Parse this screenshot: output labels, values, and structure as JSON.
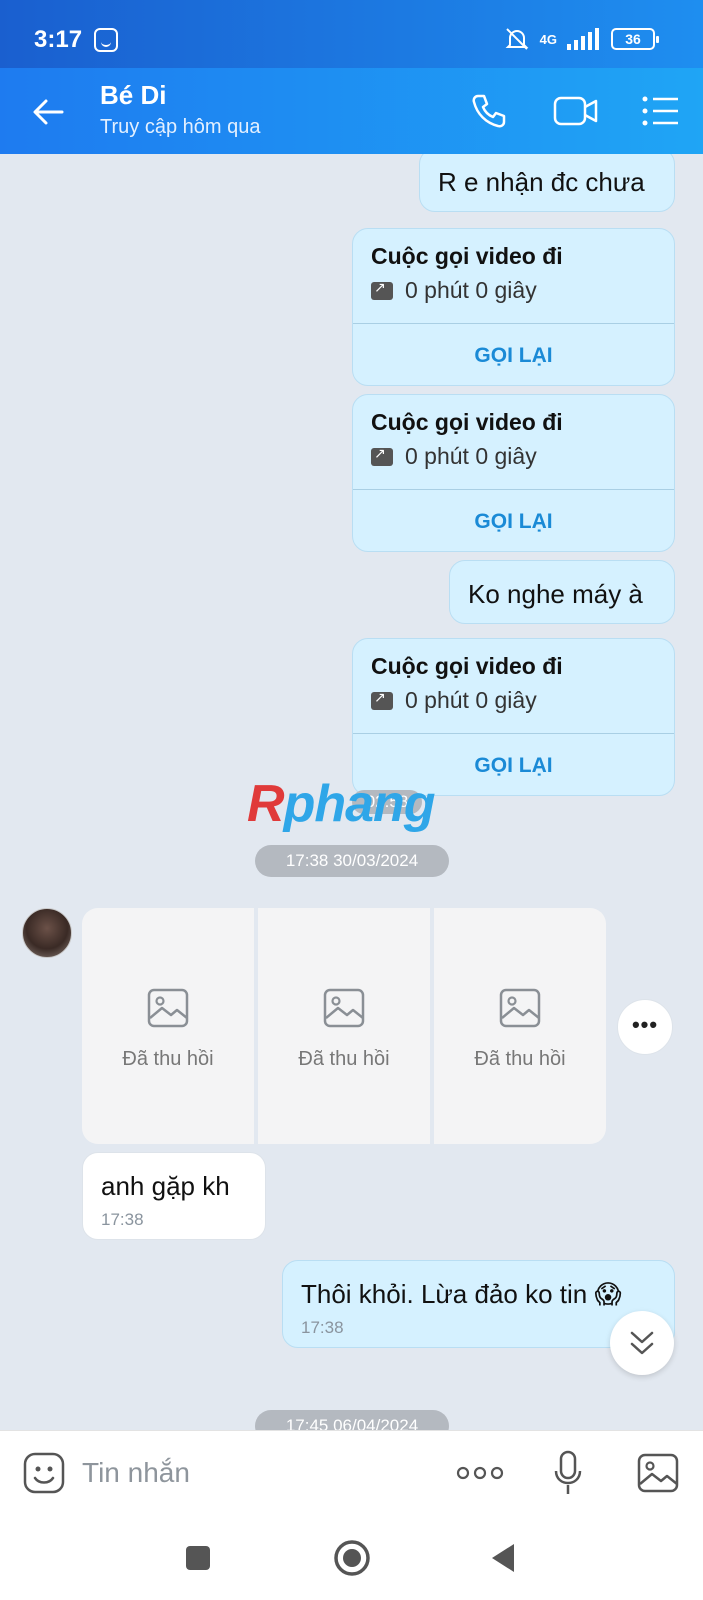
{
  "status_bar": {
    "time": "3:17",
    "network": "4G",
    "battery": "36"
  },
  "header": {
    "contact_name": "Bé Di",
    "contact_status": "Truy cập hôm qua"
  },
  "messages": {
    "m1": "R e nhận đc chưa",
    "m2": "Ko nghe máy à",
    "in_text": "anh gặp kh",
    "in_time": "17:38",
    "out_text": "Thôi khỏi. Lừa đảo ko tin 😱",
    "out_time": "17:38"
  },
  "calls": [
    {
      "title": "Cuộc gọi video đi",
      "duration": "0 phút 0 giây",
      "action": "GỌI LẠI"
    },
    {
      "title": "Cuộc gọi video đi",
      "duration": "0 phút 0 giây",
      "action": "GỌI LẠI"
    },
    {
      "title": "Cuộc gọi video đi",
      "duration": "0 phút 0 giây",
      "action": "GỌI LẠI"
    }
  ],
  "call_time": "02:58",
  "date_separators": [
    "17:38 30/03/2024",
    "17:45 06/04/2024"
  ],
  "recalled": [
    "Đã thu hồi",
    "Đã thu hồi",
    "Đã thu hồi"
  ],
  "more_button": "•••",
  "watermark": {
    "first": "R",
    "rest": "phang"
  },
  "input": {
    "placeholder": "Tin nhắn"
  },
  "icons": [
    "back-arrow-icon",
    "phone-icon",
    "video-call-icon",
    "menu-icon",
    "sticker-icon",
    "more-dots-icon",
    "microphone-icon",
    "image-icon",
    "chevron-double-down-icon"
  ],
  "colors": {
    "header_start": "#1e7bf0",
    "header_end": "#1fa5f5",
    "bubble_out": "#d5f1ff",
    "link": "#1a8ad6",
    "chat_bg": "#e2e8f0"
  }
}
